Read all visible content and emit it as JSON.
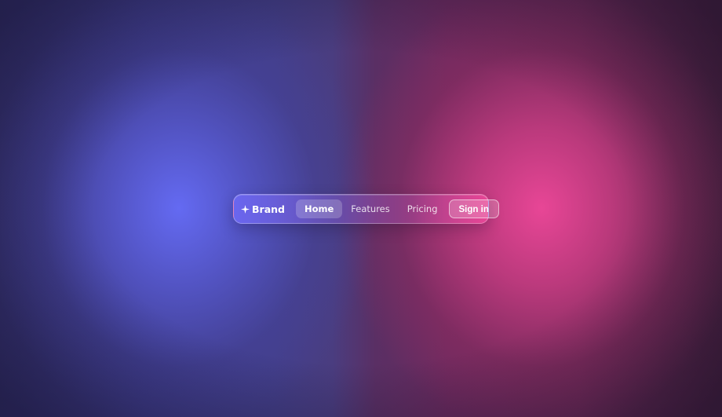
{
  "colors": {
    "left_glow": "#6366f1",
    "right_glow": "#ec4899",
    "text": "#ffffff"
  },
  "navbar": {
    "brand": {
      "icon": "sparkle-icon",
      "label": "Brand"
    },
    "links": [
      {
        "label": "Home",
        "active": true
      },
      {
        "label": "Features",
        "active": false
      },
      {
        "label": "Pricing",
        "active": false
      }
    ],
    "cta_label": "Sign in"
  }
}
